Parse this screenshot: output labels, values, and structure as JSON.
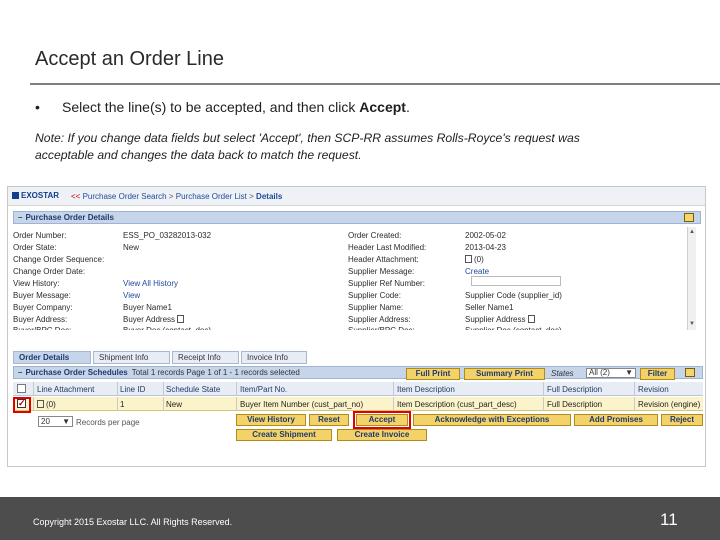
{
  "slide": {
    "title": "Accept an Order Line",
    "bullet_char": "•",
    "bullet_text": "Select the line(s) to be accepted, and then click ",
    "bullet_bold": "Accept",
    "bullet_end": ".",
    "note_line1": "Note:  If you change data fields but select 'Accept', then SCP-RR assumes Rolls-Royce's request was",
    "note_line2": "acceptable and changes the data back to match the request.",
    "copyright": "Copyright 2015 Exostar LLC. All Rights Reserved.",
    "page_number": "11"
  },
  "app": {
    "logo": "EXOSTAR",
    "breadcrumb": {
      "back": "<<",
      "item1": "Purchase Order Search",
      "sep": ">",
      "item2": "Purchase Order List",
      "current": "Details"
    },
    "po_section": {
      "title": "Purchase Order Details",
      "left_labels": [
        "Order Number:",
        "Order State:",
        "Change Order Sequence:",
        "Change Order Date:",
        "View History:",
        "Buyer Message:",
        "Buyer Company:",
        "Buyer Address:"
      ],
      "left_values": [
        "ESS_PO_03282013-032",
        "New",
        "",
        "",
        "View All History",
        "View",
        "Buyer Name1",
        "Buyer Address"
      ],
      "mid_labels": [
        "Order Created:",
        "Header Last Modified:",
        "Header Attachment:",
        "Supplier Message:",
        "Supplier Ref Number:",
        "Supplier Code:",
        "Supplier Name:",
        "Supplier Address:"
      ],
      "right_values": [
        "2002-05-02",
        "2013-04-23",
        "(0)",
        "Create",
        "",
        "Supplier Code (supplier_id)",
        "Seller Name1",
        "Supplier Address"
      ],
      "cut_label": "Buyer/BPC Doc:",
      "cut_value_left": "Buyer Doc (contact_doc)",
      "cut_label_mid": "Supplier/BPC Doc:",
      "cut_value_right": "Supplier Doc (contact_doc)"
    },
    "tabs": [
      "Order Details",
      "Shipment Info",
      "Receipt Info",
      "Invoice Info"
    ],
    "schedules": {
      "title": "Purchase Order Schedules",
      "summary": "Total 1 records Page 1 of 1  - 1 records selected",
      "full_print": "Full Print",
      "summary_print": "Summary Print",
      "states_label": "States",
      "states_value": "All (2)",
      "filter": "Filter",
      "columns": [
        "Line Attachment",
        "Line ID",
        "Schedule State",
        "Item/Part No.",
        "Item Description",
        "Full Description",
        "Revision"
      ],
      "row": {
        "attachment": "(0)",
        "line_id": "1",
        "state": "New",
        "item": "Buyer Item Number (cust_part_no)",
        "description": "Item Description (cust_part_desc)",
        "full_description": "Full Description",
        "revision": "Revision (engine)"
      },
      "page_size": "20",
      "page_size_label": "Records per page",
      "buttons": [
        "View History",
        "Reset",
        "Accept",
        "Acknowledge with Exceptions",
        "Add Promises",
        "Reject",
        "Create Shipment",
        "Create Invoice"
      ]
    }
  },
  "colors": {
    "highlight": "#e00000",
    "button": "#f3d26a",
    "footer": "#4d4d4d"
  }
}
